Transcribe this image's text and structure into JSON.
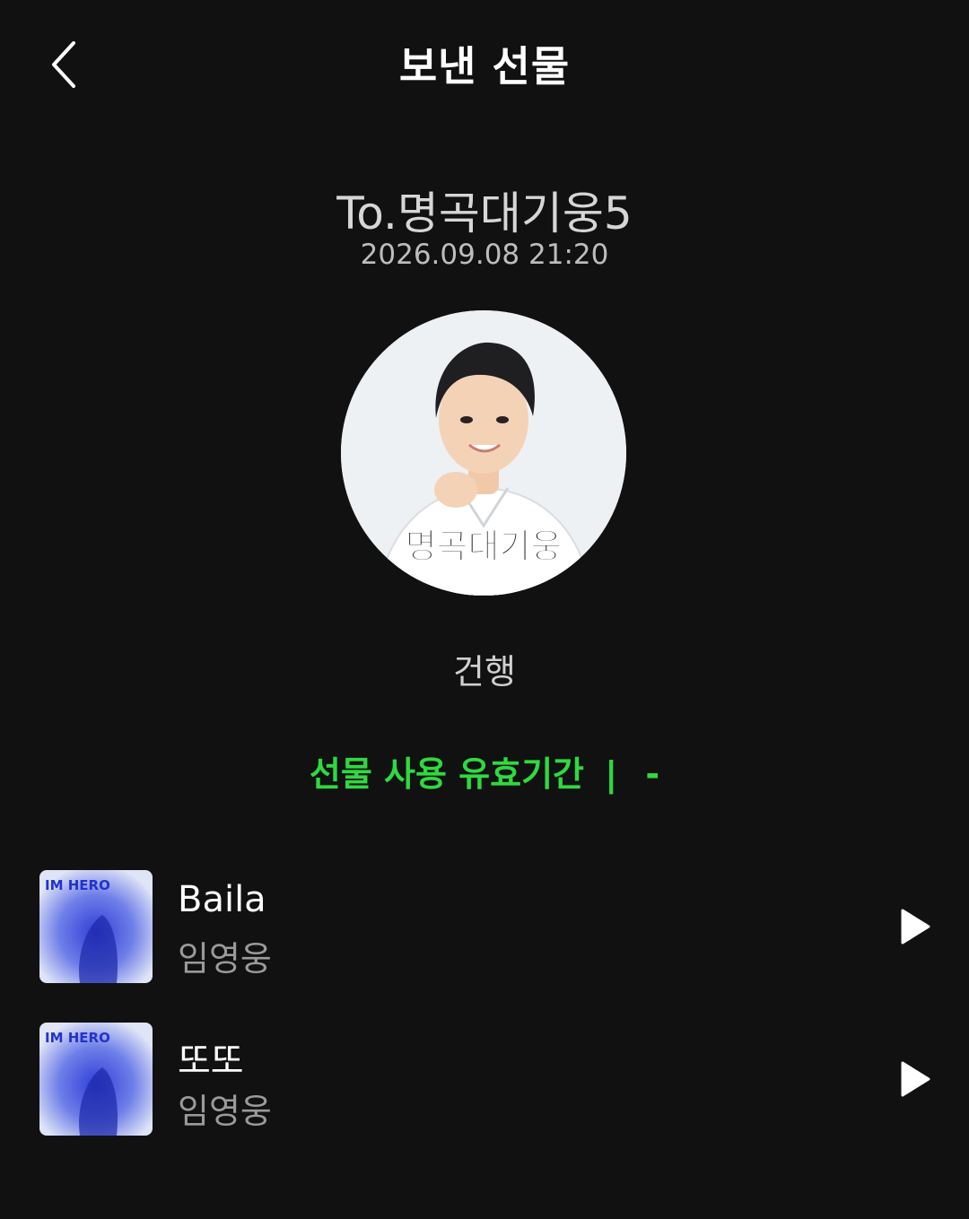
{
  "header": {
    "title": "보낸 선물",
    "back_icon": "chevron-left-icon"
  },
  "gift": {
    "recipient": "To.명곡대기웅5",
    "date": "2026.09.08 21:20",
    "avatar_caption": "명곡대기웅",
    "message": "건행",
    "validity_label": "선물 사용 유효기간",
    "validity_separator": "|",
    "validity_value": "-"
  },
  "tracks": [
    {
      "title": "Baila",
      "artist": "임영웅",
      "album_label": "IM HERO"
    },
    {
      "title": "또또",
      "artist": "임영웅",
      "album_label": "IM HERO"
    }
  ],
  "colors": {
    "background": "#111111",
    "accent_green": "#2fd93f",
    "text_primary": "#ffffff",
    "text_secondary": "#9a9a9a"
  }
}
